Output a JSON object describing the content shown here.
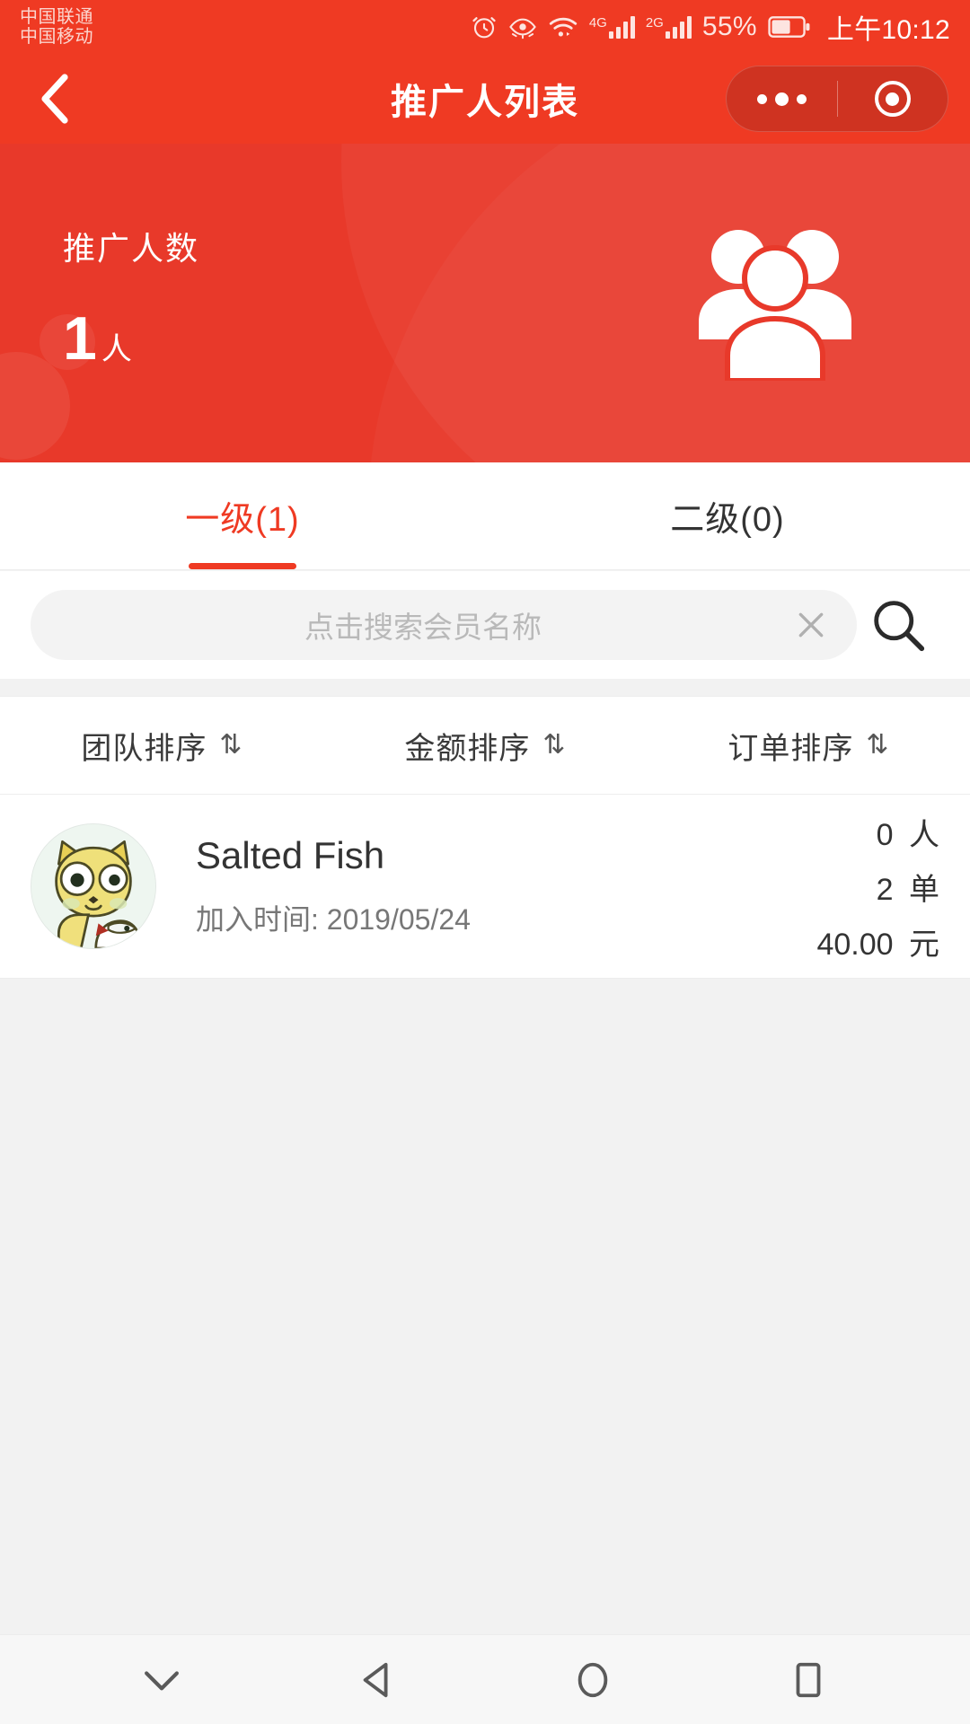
{
  "status_bar": {
    "carrier_1": "中国联通",
    "carrier_2": "中国移动",
    "signal_1_label": "4G",
    "signal_2_label": "2G",
    "battery_percent": "55%",
    "time": "上午10:12",
    "icons": [
      "alarm-icon",
      "eye-comfort-icon",
      "wifi-icon",
      "signal-icon",
      "signal-icon",
      "battery-icon"
    ]
  },
  "nav_bar": {
    "title": "推广人列表",
    "back_icon": "chevron-left-icon",
    "capsule_more_icon": "more-dots-icon",
    "capsule_target_icon": "target-circle-icon"
  },
  "hero": {
    "label": "推广人数",
    "value": "1",
    "unit": "人",
    "icon": "group-people-icon"
  },
  "tabs": [
    {
      "label": "一级(1)",
      "active": true
    },
    {
      "label": "二级(0)",
      "active": false
    }
  ],
  "search": {
    "placeholder": "点击搜索会员名称",
    "value": "",
    "clear_icon": "close-x-icon",
    "search_icon": "magnifier-icon"
  },
  "sort_options": [
    {
      "label": "团队排序",
      "icon": "sort-updown-icon"
    },
    {
      "label": "金额排序",
      "icon": "sort-updown-icon"
    },
    {
      "label": "订单排序",
      "icon": "sort-updown-icon"
    }
  ],
  "members": [
    {
      "avatar": "cat-cartoon-avatar",
      "name": "Salted Fish",
      "join_label": "加入时间: 2019/05/24",
      "people_num": "0",
      "people_unit": "人",
      "orders_num": "2",
      "orders_unit": "单",
      "amount_num": "40.00",
      "amount_unit": "元"
    }
  ],
  "bottom_nav": [
    {
      "icon": "chevron-down-icon"
    },
    {
      "icon": "back-triangle-icon"
    },
    {
      "icon": "home-circle-icon"
    },
    {
      "icon": "recents-square-icon"
    }
  ],
  "colors": {
    "primary_red": "#ef3a23",
    "hero_red": "#e8392a",
    "capsule_red": "#cf3321",
    "page_bg": "#f2f2f2",
    "text_dark": "#333333",
    "text_muted": "#777777"
  }
}
